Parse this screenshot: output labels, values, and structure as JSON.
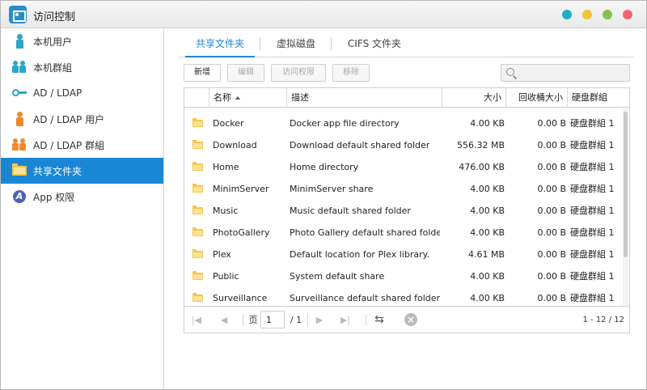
{
  "window": {
    "title": "访问控制"
  },
  "sidebar": {
    "items": [
      {
        "label": "本机用户",
        "icon": "user-icon"
      },
      {
        "label": "本机群組",
        "icon": "group-icon"
      },
      {
        "label": "AD / LDAP",
        "icon": "key-icon"
      },
      {
        "label": "AD / LDAP 用户",
        "icon": "ldap-user-icon"
      },
      {
        "label": "AD / LDAP 群組",
        "icon": "ldap-group-icon"
      },
      {
        "label": "共享文件夹",
        "icon": "folder-icon",
        "active": true
      },
      {
        "label": "App 权限",
        "icon": "app-icon"
      }
    ]
  },
  "tabs": [
    {
      "label": "共享文件夹",
      "active": true
    },
    {
      "label": "虚拟磁盘"
    },
    {
      "label": "CIFS 文件夹"
    }
  ],
  "toolbar": {
    "add": "新增",
    "edit": "编辑",
    "permissions": "访问权限",
    "remove": "移除"
  },
  "search": {
    "placeholder": ""
  },
  "table": {
    "columns": [
      "名称",
      "描述",
      "大小",
      "回收桶大小",
      "硬盘群組"
    ],
    "rows": [
      {
        "name": "Docker",
        "desc": "Docker app file directory",
        "size": "4.00 KB",
        "recycle": "0.00 B",
        "group": "硬盘群組 1"
      },
      {
        "name": "Download",
        "desc": "Download default shared folder",
        "size": "556.32 MB",
        "recycle": "0.00 B",
        "group": "硬盘群組 1"
      },
      {
        "name": "Home",
        "desc": "Home directory",
        "size": "476.00 KB",
        "recycle": "0.00 B",
        "group": "硬盘群組 1"
      },
      {
        "name": "MinimServer",
        "desc": "MinimServer share",
        "size": "4.00 KB",
        "recycle": "0.00 B",
        "group": "硬盘群組 1"
      },
      {
        "name": "Music",
        "desc": "Music default shared folder",
        "size": "4.00 KB",
        "recycle": "0.00 B",
        "group": "硬盘群組 1"
      },
      {
        "name": "PhotoGallery",
        "desc": "Photo Gallery default shared folder",
        "size": "4.00 KB",
        "recycle": "0.00 B",
        "group": "硬盘群組 1"
      },
      {
        "name": "Plex",
        "desc": "Default location for Plex library.",
        "size": "4.61 MB",
        "recycle": "0.00 B",
        "group": "硬盘群組 1"
      },
      {
        "name": "Public",
        "desc": "System default share",
        "size": "4.00 KB",
        "recycle": "0.00 B",
        "group": "硬盘群組 1"
      },
      {
        "name": "Surveillance",
        "desc": "Surveillance default shared folder",
        "size": "4.00 KB",
        "recycle": "0.00 B",
        "group": "硬盘群組 1"
      }
    ]
  },
  "pager": {
    "page_label": "页",
    "page_value": "1",
    "total_pages": "/ 1",
    "count": "1 - 12 / 12"
  },
  "colors": {
    "accent": "#1a87d5",
    "folder": "#f6c54a",
    "dot_teal": "#1fb1c1",
    "dot_yellow": "#f2c53a",
    "dot_green": "#86c14a",
    "dot_red": "#ee6674"
  }
}
